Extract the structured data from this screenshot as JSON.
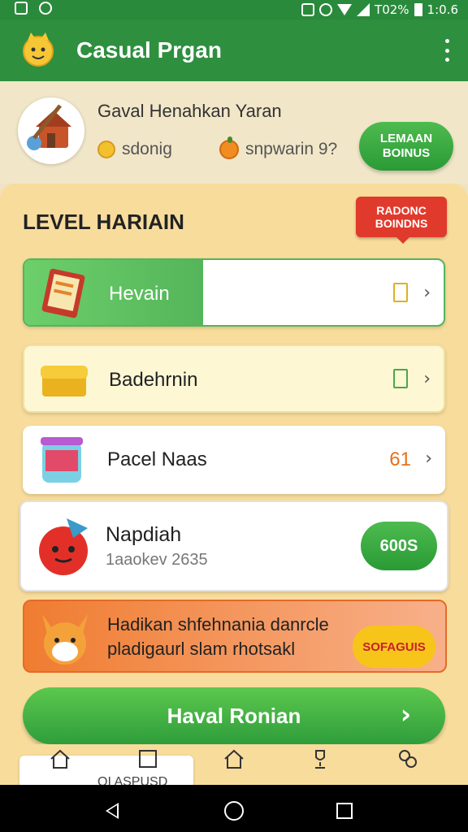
{
  "status_bar": {
    "battery": "T02%",
    "time": "1:0.6",
    "icons": [
      "gallery-icon",
      "app-icon",
      "notification-icon",
      "alarm-icon",
      "wifi-icon",
      "signal-icon",
      "battery-icon"
    ]
  },
  "app_bar": {
    "title": "Casual Prgan",
    "icons": [
      "app-logo-icon",
      "more-vert-icon"
    ]
  },
  "profile": {
    "name": "Gaval Henahkan Yaran",
    "stat_coins": "sdonig",
    "stat_fruit": "snpwarin 9?",
    "bonus_button": {
      "line1": "LEMAAN",
      "line2": "BOINUS"
    }
  },
  "level": {
    "title": "LEVEL HARIAIN",
    "badge": {
      "line1": "RADONC",
      "line2": "BOINDNS"
    }
  },
  "cards": [
    {
      "label": "Hevain",
      "icon": "notebook-icon",
      "trailing_icon": "gift-icon"
    },
    {
      "label": "Badehrnin",
      "icon": "treasure-box-icon",
      "trailing_icon": "gift-icon"
    },
    {
      "label": "Pacel Naas",
      "icon": "jar-icon",
      "value": "61"
    }
  ],
  "featured": {
    "label": "Napdiah",
    "sub": "1aaokev 2635",
    "button": "600S",
    "icon": "red-creature-icon"
  },
  "promo": {
    "line1": "Hadikan shfehnania danrcle",
    "line2": "pladigaurl slam rhotsakl",
    "button": "SOFAGUIS",
    "icon": "fox-icon"
  },
  "main_button": "Haval Ronian",
  "tab_card_text": "QI ASPUSD",
  "tabs": [
    "home-icon",
    "square-icon",
    "home-icon",
    "trophy-icon",
    "settings-icon"
  ],
  "colors": {
    "primary_green": "#2e8f3f",
    "panel": "#f8dc9c",
    "badge_red": "#e03a2c",
    "promo_orange": "#f07c30"
  }
}
